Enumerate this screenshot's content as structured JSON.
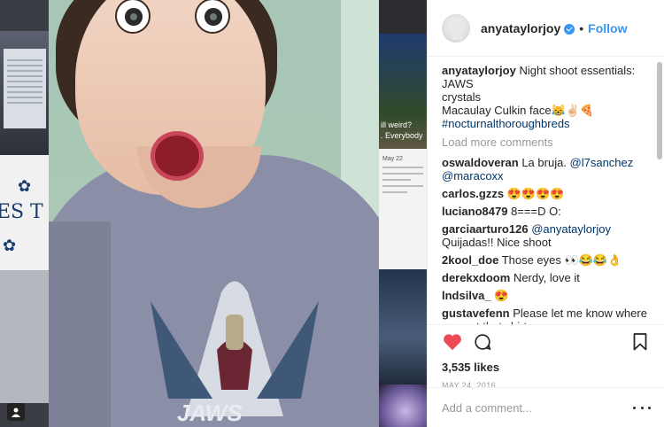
{
  "post": {
    "username": "anyataylorjoy",
    "follow_label": "Follow",
    "separator": "•",
    "caption_lines": [
      "Night shoot essentials:",
      "JAWS",
      "crystals",
      "Macaulay Culkin face😹✌🏻🍕",
      "#nocturnalthoroughbreds"
    ],
    "load_more_label": "Load more comments",
    "comments": [
      {
        "user": "oswaldoveran",
        "parts": [
          {
            "t": "La bruja. "
          },
          {
            "t": "@l7sanchez",
            "link": true
          },
          {
            "t": " "
          },
          {
            "t": "@maracoxx",
            "link": true
          }
        ]
      },
      {
        "user": "carlos.gzzs",
        "parts": [
          {
            "t": "😍😍😍😍"
          }
        ]
      },
      {
        "user": "luciano8479",
        "parts": [
          {
            "t": "8===D O:"
          }
        ]
      },
      {
        "user": "garciaarturo126",
        "parts": [
          {
            "t": "@anyataylorjoy",
            "link": true
          },
          {
            "t": " Quijadas!! Nice shoot"
          }
        ]
      },
      {
        "user": "2kool_doe",
        "parts": [
          {
            "t": "Those eyes 👀😂😂👌"
          }
        ]
      },
      {
        "user": "derekxdoom",
        "parts": [
          {
            "t": "Nerdy, love it"
          }
        ]
      },
      {
        "user": "lndsilva_",
        "parts": [
          {
            "t": "😍"
          }
        ]
      },
      {
        "user": "gustavefenn",
        "parts": [
          {
            "t": "Please let me know where you got that shirt"
          }
        ]
      }
    ],
    "likes": "3,535 likes",
    "date": "MAY 24, 2016",
    "add_comment_placeholder": "Add a comment...",
    "like_color": "#ed4956",
    "accent_color": "#3897f0",
    "icons": [
      "heart-icon",
      "comment-icon",
      "bookmark-icon",
      "more-options-icon",
      "verified-badge-icon"
    ]
  },
  "background": {
    "mid_caption_1": "ill weird?",
    "mid_caption_2": ". Everybody",
    "mid_date": "May 22",
    "left_letters": [
      "E",
      "S",
      "T"
    ],
    "left_glyph": "✿"
  },
  "photo": {
    "shirt_text": "JAWS"
  }
}
